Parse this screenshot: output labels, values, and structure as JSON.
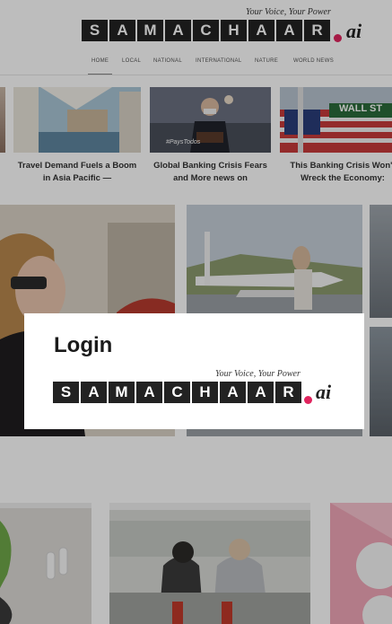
{
  "brand": {
    "letters": [
      "S",
      "A",
      "M",
      "A",
      "C",
      "H",
      "A",
      "A",
      "R"
    ],
    "suffix": "ai",
    "tagline": "Your Voice, Your Power",
    "dot_color": "#e0245e"
  },
  "nav": {
    "items": [
      {
        "label": "HOME",
        "active": true
      },
      {
        "label": "LOCAL",
        "active": false
      },
      {
        "label": "NATIONAL",
        "active": false
      },
      {
        "label": "INTERNATIONAL",
        "active": false
      },
      {
        "label": "NATURE",
        "active": false
      },
      {
        "label": "WORLD NEWS",
        "active": false
      }
    ]
  },
  "top_stories": [
    {
      "title": "Travel Demand Fuels a Boom in Asia Pacific —"
    },
    {
      "title": "Global Banking Crisis Fears and More news on",
      "image_text": "#PaysTodos"
    },
    {
      "title": "This Banking Crisis Won't Wreck the Economy:",
      "image_text": "WALL ST"
    }
  ],
  "modal": {
    "title": "Login"
  }
}
